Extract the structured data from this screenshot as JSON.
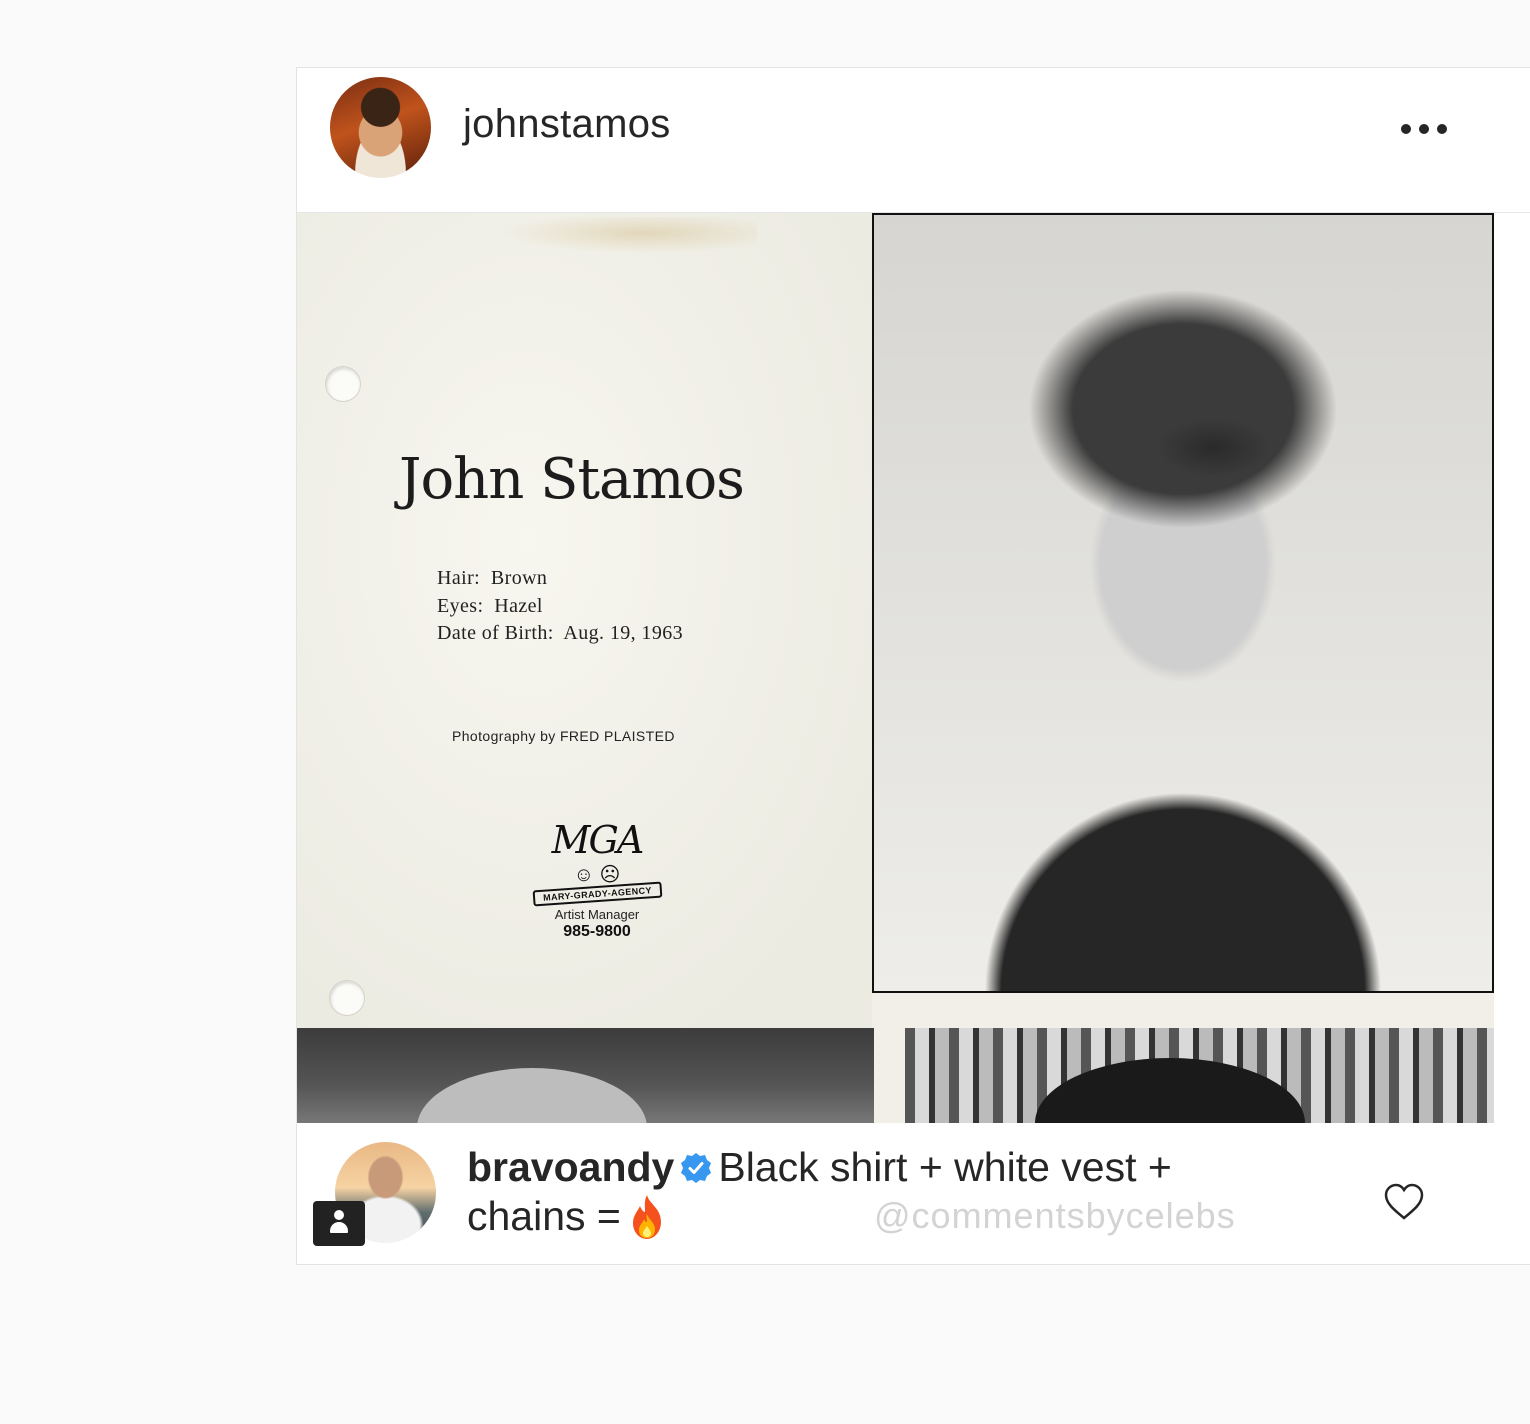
{
  "post": {
    "author_username": "johnstamos",
    "menu_icon": "more-dots-icon",
    "photo": {
      "name": "John Stamos",
      "stats": [
        "Hair:  Brown",
        "Eyes:  Hazel",
        "Date of Birth:  Aug. 19, 1963"
      ],
      "photography": "Photography by FRED PLAISTED",
      "agency": {
        "logo_text": "MGA",
        "ribbon": "MARY-GRADY-AGENCY",
        "role": "Artist Manager",
        "phone": "985-9800"
      }
    }
  },
  "comment": {
    "username": "bravoandy",
    "verified_icon": "verified-badge-icon",
    "text": "Black shirt + white vest + chains =",
    "emoji_icon": "fire-icon",
    "watermark": "@commentsbycelebs",
    "like_icon": "heart-outline-icon",
    "badge_icon": "person-icon"
  },
  "colors": {
    "verified": "#3897f0",
    "text": "#262626",
    "watermark": "#d3d3d3"
  }
}
